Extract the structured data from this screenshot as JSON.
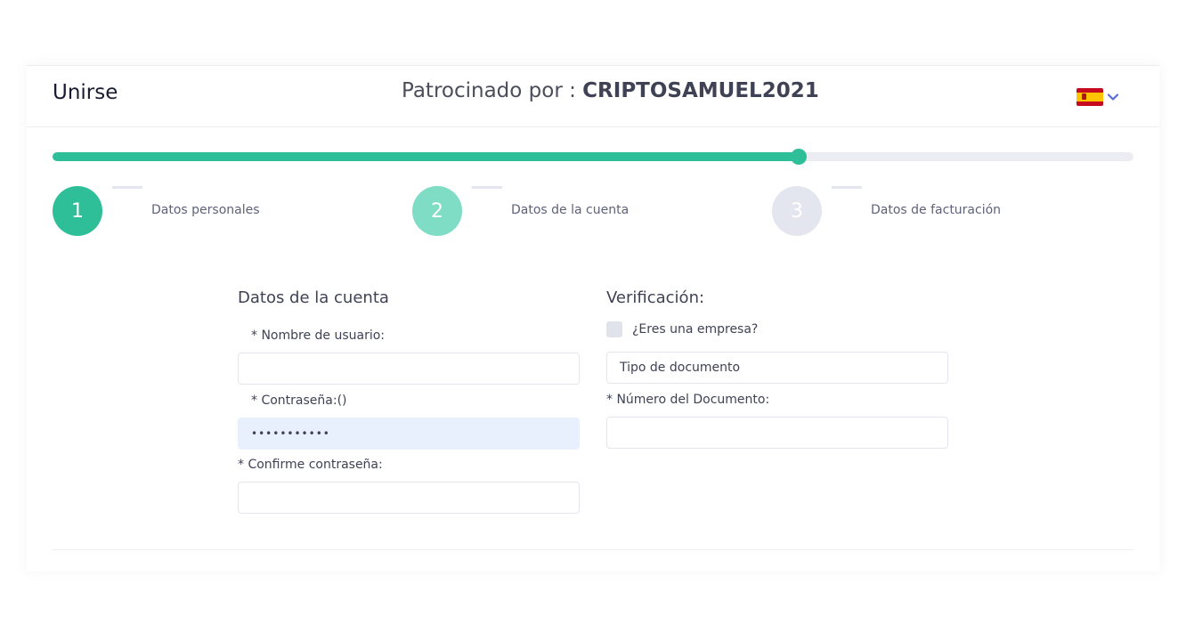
{
  "header": {
    "title": "Unirse",
    "sponsor_prefix": "Patrocinado por :",
    "sponsor_code": "CRIPTOSAMUEL2021",
    "language_flag_icon": "spain-flag-icon",
    "language_chevron_icon": "chevron-down-icon"
  },
  "progress": {
    "fraction": 0.69
  },
  "steps": [
    {
      "number": "1",
      "label": "Datos personales",
      "state": "completed",
      "color": "#2fbf98"
    },
    {
      "number": "2",
      "label": "Datos de la cuenta",
      "state": "current",
      "color": "#7fdcc5"
    },
    {
      "number": "3",
      "label": "Datos de facturación",
      "state": "pending",
      "color": "#e4e6ef"
    }
  ],
  "account": {
    "section_title": "Datos de la cuenta",
    "username_label": "* Nombre de usuario:",
    "username_value": "",
    "password_label": "* Contraseña:()",
    "password_value": "•••••••••••",
    "confirm_label": "* Confirme contraseña:",
    "confirm_value": ""
  },
  "verification": {
    "section_title": "Verificación:",
    "company_checkbox_label": "¿Eres una empresa?",
    "company_checked": false,
    "document_type_value": "Tipo de documento",
    "document_number_label": "* Número del Documento:",
    "document_number_value": ""
  },
  "colors": {
    "accent": "#2fbf98",
    "accent_light": "#7fdcc5",
    "track": "#ebedf3",
    "autofill_bg": "#e8f0fe"
  }
}
